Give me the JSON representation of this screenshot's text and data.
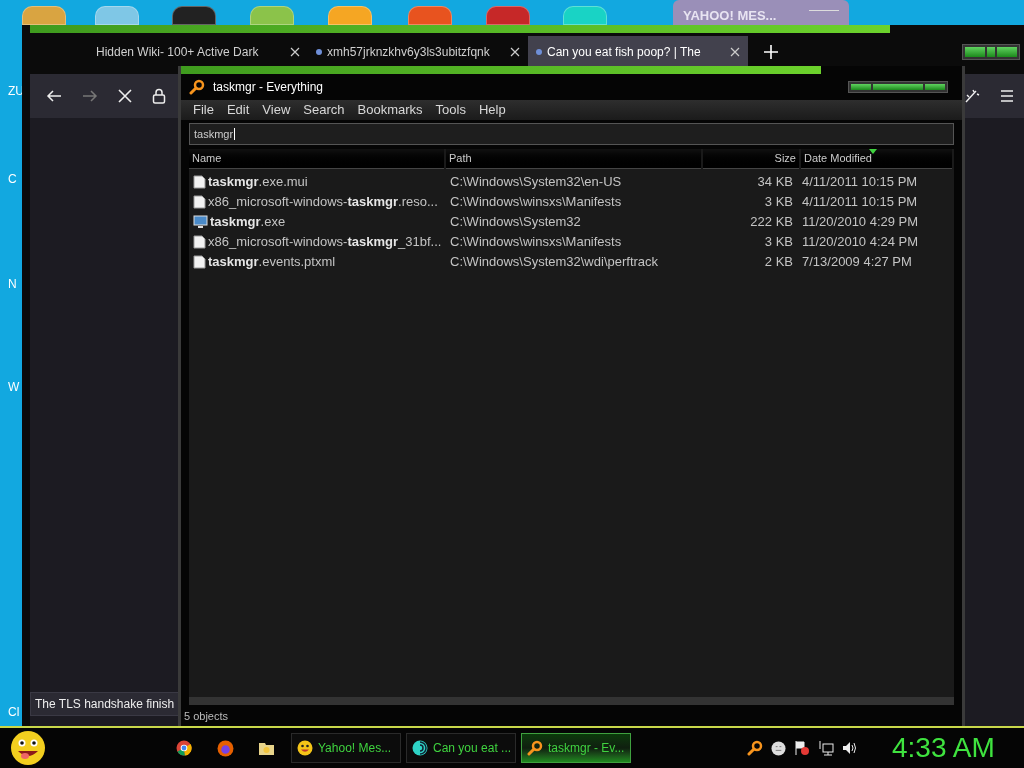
{
  "desktop": {
    "icon_labels": [
      "ZU",
      "C",
      "N",
      "W",
      "Cl"
    ]
  },
  "background_window": {
    "title": "YAHOO! MES..."
  },
  "browser": {
    "tabs": [
      {
        "title": "Hidden Wiki- 100+ Active Dark",
        "loading": false,
        "selected": false
      },
      {
        "title": "xmh57jrknzkhv6y3ls3ubitzfqnk",
        "loading": true,
        "selected": false
      },
      {
        "title": "Can you eat fish poop? | The",
        "loading": true,
        "selected": true
      }
    ],
    "status_text": "The TLS handshake finish"
  },
  "everything": {
    "title": "taskmgr - Everything",
    "menu": [
      "File",
      "Edit",
      "View",
      "Search",
      "Bookmarks",
      "Tools",
      "Help"
    ],
    "search": {
      "value": "taskmgr"
    },
    "columns": [
      {
        "label": "Name",
        "sorted": false
      },
      {
        "label": "Path",
        "sorted": false
      },
      {
        "label": "Size",
        "sorted": false
      },
      {
        "label": "Date Modified",
        "sorted": true
      }
    ],
    "rows": [
      {
        "kind": "file",
        "name": "**taskmgr**.exe.mui",
        "path": "C:\\Windows\\System32\\en-US",
        "size": "34 KB",
        "date_modified": "4/11/2011 10:15 PM"
      },
      {
        "kind": "file",
        "name": "x86_microsoft-windows-**taskmgr**.reso...",
        "path": "C:\\Windows\\winsxs\\Manifests",
        "size": "3 KB",
        "date_modified": "4/11/2011 10:15 PM"
      },
      {
        "kind": "exe",
        "name": "**taskmgr**.exe",
        "path": "C:\\Windows\\System32",
        "size": "222 KB",
        "date_modified": "11/20/2010 4:29 PM"
      },
      {
        "kind": "file",
        "name": "x86_microsoft-windows-**taskmgr**_31bf...",
        "path": "C:\\Windows\\winsxs\\Manifests",
        "size": "3 KB",
        "date_modified": "11/20/2010 4:24 PM"
      },
      {
        "kind": "file",
        "name": "**taskmgr**.events.ptxml",
        "path": "C:\\Windows\\System32\\wdi\\perftrack",
        "size": "2 KB",
        "date_modified": "7/13/2009 4:27 PM"
      }
    ],
    "status": "5 objects"
  },
  "taskbar": {
    "buttons": [
      {
        "kind": "yahoo",
        "label": "Yahoo! Mes...",
        "selected": false
      },
      {
        "kind": "browser",
        "label": "Can you eat ...",
        "selected": false
      },
      {
        "kind": "search",
        "label": "taskmgr - Ev...",
        "selected": true
      }
    ],
    "clock": "4:33 AM"
  }
}
